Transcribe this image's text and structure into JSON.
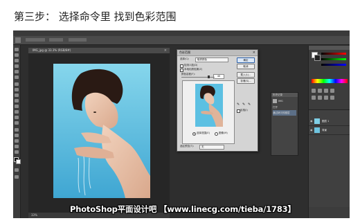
{
  "heading": "第三步： 选择命令里 找到色彩范围",
  "app": {
    "document_tab": "IMG_jpg @ 33.3% (RGB/8#)",
    "status_zoom": "33%",
    "color_range_dialog": {
      "title": "色彩范围",
      "select_label": "选择(C):",
      "select_value": "取样颜色",
      "detect_faces": "检测人脸(D)",
      "localized_clusters": "本地化颜色簇(Z)",
      "fuzziness_label": "颜色容差(F):",
      "fuzziness_value": "40",
      "range_label": "范围(R):",
      "buttons": {
        "ok": "确定",
        "cancel": "取消",
        "load": "载入(L)...",
        "save": "存储(S)..."
      },
      "invert": "反相(I)",
      "radio_selection": "选择范围(E)",
      "radio_image": "图像(M)",
      "selection_preview_label": "选区预览(T):",
      "selection_preview_value": "无"
    },
    "history_panel": {
      "title": "历史记录",
      "items": [
        "IMG",
        "打开",
        "通过拷贝的图层"
      ]
    },
    "layers_panel": {
      "layers": [
        "图层 1",
        "背景"
      ]
    }
  },
  "watermark": "PhotoShop平面设计吧 【www.linecg.com/tieba/1783】",
  "colors": {
    "photo_bg_top": "#7ed3ea",
    "photo_bg_bottom": "#3fa8d4",
    "dialog_bg": "#d4d4d4",
    "ps_bg": "#2e2e2e"
  }
}
